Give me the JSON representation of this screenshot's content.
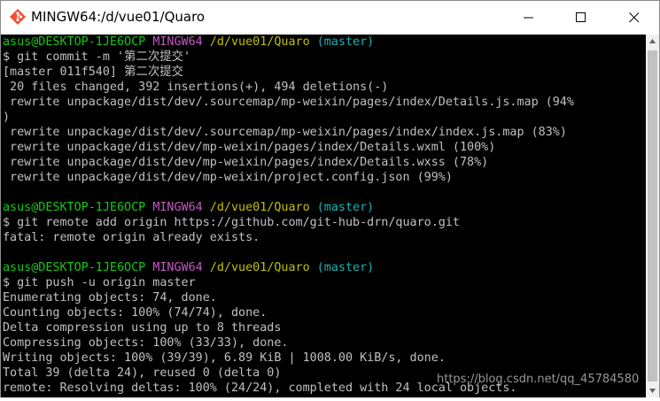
{
  "window": {
    "title": "MINGW64:/d/vue01/Quaro",
    "controls": {
      "minimize": "─",
      "maximize": "☐",
      "close": "✕"
    },
    "icon": "git-bash-icon"
  },
  "colors": {
    "background": "#000000",
    "text": "#c0c0c0",
    "prompt_user": "#14c814",
    "prompt_env": "#c25ac2",
    "prompt_path": "#c0c000",
    "prompt_branch": "#19b2b2"
  },
  "prompt": {
    "user": "asus@DESKTOP-1JE6OCP",
    "env": "MINGW64",
    "path": "/d/vue01/Quaro",
    "branch": "(master)"
  },
  "terminal": {
    "block1": {
      "cmd": "$ git commit -m '第二次提交'",
      "out1": "[master 011f540] 第二次提交",
      "out2": " 20 files changed, 392 insertions(+), 494 deletions(-)",
      "out3": " rewrite unpackage/dist/dev/.sourcemap/mp-weixin/pages/index/Details.js.map (94%",
      "out4": ")",
      "out5": " rewrite unpackage/dist/dev/.sourcemap/mp-weixin/pages/index/index.js.map (83%)",
      "out6": " rewrite unpackage/dist/dev/mp-weixin/pages/index/Details.wxml (100%)",
      "out7": " rewrite unpackage/dist/dev/mp-weixin/pages/index/Details.wxss (78%)",
      "out8": " rewrite unpackage/dist/dev/mp-weixin/project.config.json (99%)"
    },
    "block2": {
      "cmd": "$ git remote add origin https://github.com/git-hub-drn/quaro.git",
      "out1": "fatal: remote origin already exists."
    },
    "block3": {
      "cmd": "$ git push -u origin master",
      "out1": "Enumerating objects: 74, done.",
      "out2": "Counting objects: 100% (74/74), done.",
      "out3": "Delta compression using up to 8 threads",
      "out4": "Compressing objects: 100% (33/33), done.",
      "out5": "Writing objects: 100% (39/39), 6.89 KiB | 1008.00 KiB/s, done.",
      "out6": "Total 39 (delta 24), reused 0 (delta 0)",
      "out7": "remote: Resolving deltas: 100% (24/24), completed with 24 local objects."
    }
  },
  "watermark": "https://blog.csdn.net/qq_45784580"
}
